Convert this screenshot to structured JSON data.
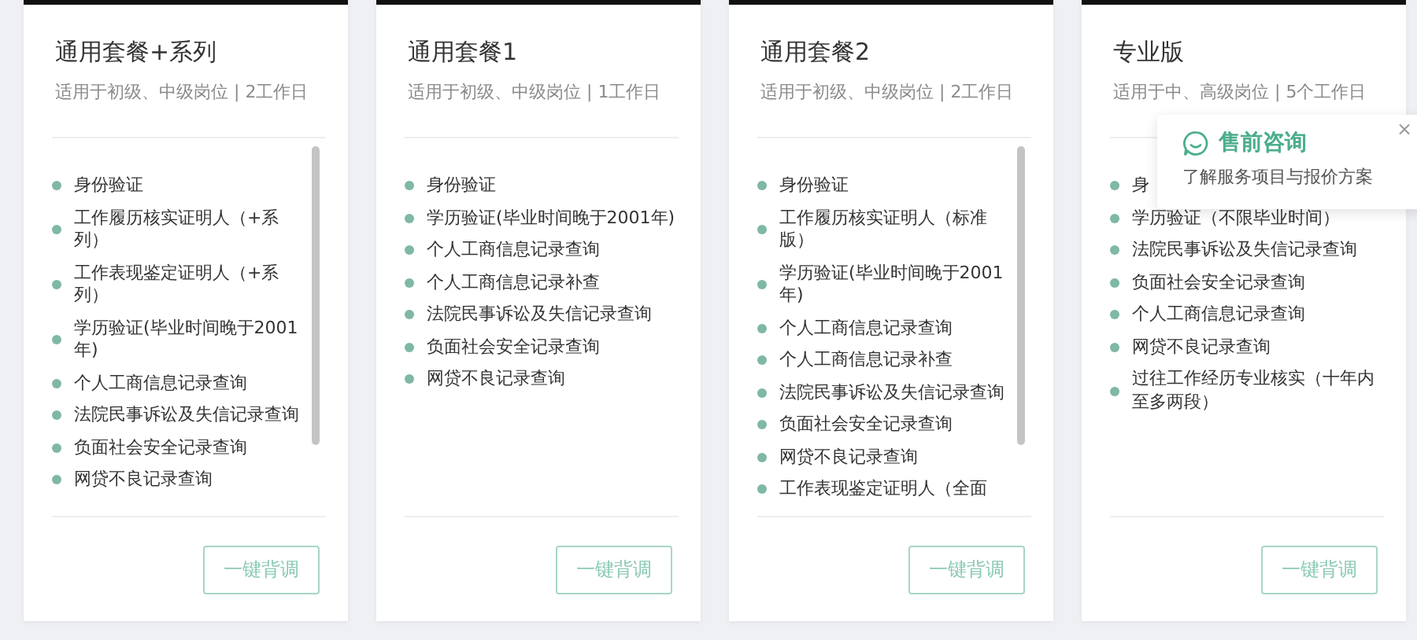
{
  "cards": [
    {
      "title": "通用套餐+系列",
      "subtitle": "适用于初级、中级岗位 | 2工作日",
      "scrollable": true,
      "items": [
        "身份验证",
        "工作履历核实证明人（+系列）",
        "工作表现鉴定证明人（+系列）",
        "学历验证(毕业时间晚于2001年)",
        "个人工商信息记录查询",
        "法院民事诉讼及失信记录查询",
        "负面社会安全记录查询",
        "网贷不良记录查询"
      ],
      "button": "一键背调"
    },
    {
      "title": "通用套餐1",
      "subtitle": "适用于初级、中级岗位 | 1工作日",
      "scrollable": false,
      "items": [
        "身份验证",
        "学历验证(毕业时间晚于2001年)",
        "个人工商信息记录查询",
        "个人工商信息记录补查",
        "法院民事诉讼及失信记录查询",
        "负面社会安全记录查询",
        "网贷不良记录查询"
      ],
      "button": "一键背调"
    },
    {
      "title": "通用套餐2",
      "subtitle": "适用于初级、中级岗位 | 2工作日",
      "scrollable": true,
      "items": [
        "身份验证",
        "工作履历核实证明人（标准版）",
        "学历验证(毕业时间晚于2001年)",
        "个人工商信息记录查询",
        "个人工商信息记录补查",
        "法院民事诉讼及失信记录查询",
        "负面社会安全记录查询",
        "网贷不良记录查询",
        "工作表现鉴定证明人（全面"
      ],
      "button": "一键背调"
    },
    {
      "title": "专业版",
      "subtitle": "适用于中、高级岗位 | 5个工作日",
      "scrollable": false,
      "items": [
        "身",
        "学历验证（不限毕业时间）",
        "法院民事诉讼及失信记录查询",
        "负面社会安全记录查询",
        "个人工商信息记录查询",
        "网贷不良记录查询",
        "过往工作经历专业核实（十年内至多两段）"
      ],
      "button": "一键背调"
    }
  ],
  "popup": {
    "title": "售前咨询",
    "text": "了解服务项目与报价方案",
    "close": "×"
  }
}
